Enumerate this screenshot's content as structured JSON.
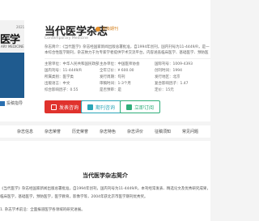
{
  "journal": {
    "title": "当代医学杂志",
    "title_tag": "省级期刊",
    "subtitle": "Contemporary Medicine",
    "description": "杂志简介：《当代医学》杂志经国家新闻出版总署批准，自1994年创刊，国内刊号为11-4449/R，是一本综合性医学期刊，杂志致力于为专家学者提供学术交流平台，内容涵盖临床医学、基础医学、预防医学等各个领域。"
  },
  "cover": {
    "text": "医学",
    "sub": "ARY MEDICINE",
    "year": "2021",
    "note": "投稿指导"
  },
  "info": [
    [
      "主管单位：中华人民共和国民政部",
      "主办单位：中国医师协会",
      "国际刊号：1009-4393"
    ],
    [
      "国内刊号：11-4449/R",
      "全年订价：¥ 600.00",
      "创刊时间：1994"
    ],
    [
      "所属类别：医学类",
      "发行周期：旬刊",
      "发行地区：北京"
    ],
    [
      "出版语言：中文",
      "审稿时间：1-3个月",
      "复合影响因子：1.47"
    ],
    [
      "综合影响因子：0.55",
      "是否预审：是",
      "定价：15元"
    ]
  ],
  "buttons": {
    "submit": "发表咨询",
    "consult": "期刊咨询",
    "subscribe": "立即订阅"
  },
  "nav": [
    "",
    "杂志信息",
    "杂志荣誉",
    "历史荣誉",
    "杂志特色",
    "杂志评价",
    "征稿须知",
    "常见问题"
  ],
  "content": {
    "title": "当代医学杂志简介",
    "paragraphs": [
      "《当代医学》杂志经国家新闻出版总署批准，自1994年创刊，国内刊号为11-4449/R，本刊经常发表、精选论文及优秀研究成果，可以刊登同行业论文...",
      "临床医学，基础医学，预防医学，医学教育，影像学等，2004年获北京市医学期刊优秀奖。",
      "1. 杂志学术前沿：全面报道医学各领域的研究进展。"
    ]
  },
  "colors": {
    "accent_red": "#e0322d",
    "accent_blue": "#2aa6b8",
    "accent_green": "#2fae7a",
    "cover_blue": "#1f5b8f"
  }
}
